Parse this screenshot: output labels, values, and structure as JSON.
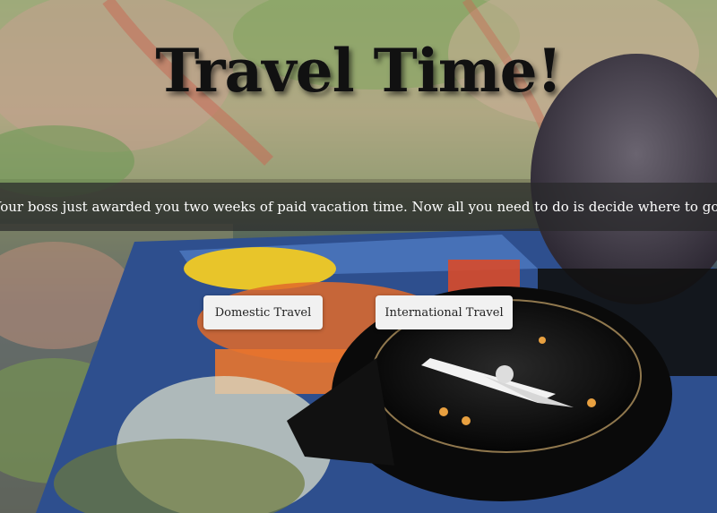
{
  "header": {
    "title": "Travel Time!"
  },
  "banner": {
    "message": "Your boss just awarded you two weeks of paid vacation time. Now all you need to do is decide where to go!"
  },
  "actions": {
    "domestic_label": "Domestic Travel",
    "international_label": "International Travel"
  },
  "colors": {
    "banner_bg": "#28282a",
    "button_bg": "#f1f1f1",
    "title_color": "#111111"
  }
}
